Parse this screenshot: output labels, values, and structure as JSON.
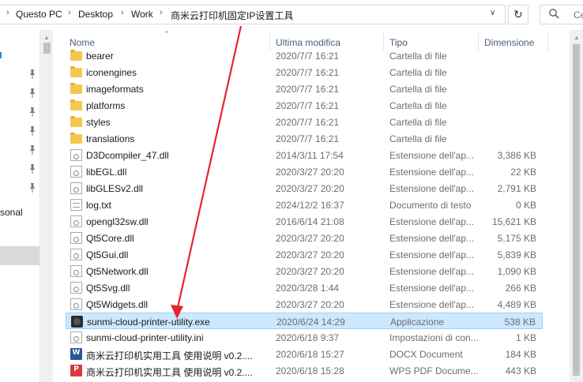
{
  "address_bar": {
    "crumbs": [
      "Questo PC",
      "Desktop",
      "Work",
      "商米云打印机固定IP设置工具"
    ],
    "search_placeholder": "Ce"
  },
  "nav": {
    "partial_label": "sonal"
  },
  "columns": {
    "name": "Nome",
    "modified": "Ultima modifica",
    "type": "Tipo",
    "size": "Dimensione"
  },
  "files": [
    {
      "name": "bearer",
      "modified": "2020/7/7 16:21",
      "type": "Cartella di file",
      "size": "",
      "icon": "folder-icon"
    },
    {
      "name": "iconengines",
      "modified": "2020/7/7 16:21",
      "type": "Cartella di file",
      "size": "",
      "icon": "folder-icon"
    },
    {
      "name": "imageformats",
      "modified": "2020/7/7 16:21",
      "type": "Cartella di file",
      "size": "",
      "icon": "folder-icon"
    },
    {
      "name": "platforms",
      "modified": "2020/7/7 16:21",
      "type": "Cartella di file",
      "size": "",
      "icon": "folder-icon"
    },
    {
      "name": "styles",
      "modified": "2020/7/7 16:21",
      "type": "Cartella di file",
      "size": "",
      "icon": "folder-icon"
    },
    {
      "name": "translations",
      "modified": "2020/7/7 16:21",
      "type": "Cartella di file",
      "size": "",
      "icon": "folder-icon"
    },
    {
      "name": "D3Dcompiler_47.dll",
      "modified": "2014/3/11 17:54",
      "type": "Estensione dell'ap...",
      "size": "3,386 KB",
      "icon": "dll-icon"
    },
    {
      "name": "libEGL.dll",
      "modified": "2020/3/27 20:20",
      "type": "Estensione dell'ap...",
      "size": "22 KB",
      "icon": "dll-icon"
    },
    {
      "name": "libGLESv2.dll",
      "modified": "2020/3/27 20:20",
      "type": "Estensione dell'ap...",
      "size": "2,791 KB",
      "icon": "dll-icon"
    },
    {
      "name": "log.txt",
      "modified": "2024/12/2 16:37",
      "type": "Documento di testo",
      "size": "0 KB",
      "icon": "text-file-icon"
    },
    {
      "name": "opengl32sw.dll",
      "modified": "2016/6/14 21:08",
      "type": "Estensione dell'ap...",
      "size": "15,621 KB",
      "icon": "dll-icon"
    },
    {
      "name": "Qt5Core.dll",
      "modified": "2020/3/27 20:20",
      "type": "Estensione dell'ap...",
      "size": "5,175 KB",
      "icon": "dll-icon"
    },
    {
      "name": "Qt5Gui.dll",
      "modified": "2020/3/27 20:20",
      "type": "Estensione dell'ap...",
      "size": "5,839 KB",
      "icon": "dll-icon"
    },
    {
      "name": "Qt5Network.dll",
      "modified": "2020/3/27 20:20",
      "type": "Estensione dell'ap...",
      "size": "1,090 KB",
      "icon": "dll-icon"
    },
    {
      "name": "Qt5Svg.dll",
      "modified": "2020/3/28 1:44",
      "type": "Estensione dell'ap...",
      "size": "266 KB",
      "icon": "dll-icon"
    },
    {
      "name": "Qt5Widgets.dll",
      "modified": "2020/3/27 20:20",
      "type": "Estensione dell'ap...",
      "size": "4,489 KB",
      "icon": "dll-icon"
    },
    {
      "name": "sunmi-cloud-printer-utility.exe",
      "modified": "2020/6/24 14:29",
      "type": "Applicazione",
      "size": "538 KB",
      "icon": "exe-icon",
      "selected": true
    },
    {
      "name": "sunmi-cloud-printer-utility.ini",
      "modified": "2020/6/18 9:37",
      "type": "Impostazioni di con...",
      "size": "1 KB",
      "icon": "ini-icon"
    },
    {
      "name": "商米云打印机实用工具 使用说明 v0.2....",
      "modified": "2020/6/18 15:27",
      "type": "DOCX Document",
      "size": "184 KB",
      "icon": "docx-icon"
    },
    {
      "name": "商米云打印机实用工具 使用说明 v0.2....",
      "modified": "2020/6/18 15:28",
      "type": "WPS PDF Docume...",
      "size": "443 KB",
      "icon": "pdf-icon"
    }
  ],
  "colors": {
    "selection_bg": "#cce8ff",
    "selection_border": "#99d1ff",
    "header_text": "#4c607a",
    "annotation_arrow": "#e8262a",
    "folder": "#f5c84c"
  }
}
